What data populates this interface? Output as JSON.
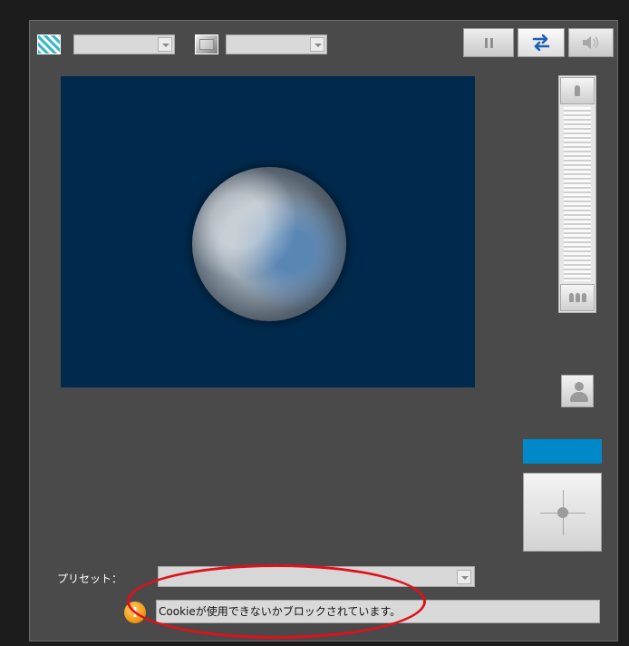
{
  "toolbar": {
    "filter_icon": "checker-pattern-icon",
    "tone_icon": "gray-square-icon",
    "combo1_value": "",
    "combo2_value": "",
    "pause_icon": "pause-icon",
    "swap_icon": "swap-arrows-icon",
    "sound_icon": "speaker-icon",
    "swap_color": "#1c5fb4"
  },
  "video": {
    "background": "#002a4d",
    "content": "earth-image"
  },
  "zoom": {
    "top_icon": "single-tree-icon",
    "bottom_icon": "trees-icon"
  },
  "controls": {
    "person_icon": "person-icon",
    "accent_color": "#0089c8",
    "pan_icon": "pan-crosshair-icon"
  },
  "preset": {
    "label": "プリセット：",
    "value": ""
  },
  "status": {
    "icon": "warning-icon",
    "icon_glyph": "!",
    "message": "Cookieが使用できないかブロックされています。"
  },
  "annotation": {
    "highlight_color": "#e0101a"
  }
}
